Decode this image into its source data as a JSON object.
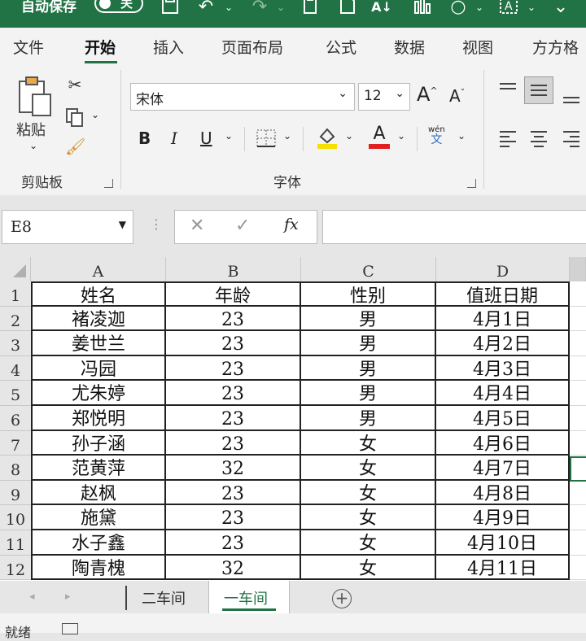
{
  "titlebar": {
    "autosave_label": "自动保存",
    "autosave_state": "关"
  },
  "ribbon_tabs": [
    "文件",
    "开始",
    "插入",
    "页面布局",
    "公式",
    "数据",
    "视图",
    "方方格"
  ],
  "active_tab": "开始",
  "clipboard": {
    "paste_label": "粘贴",
    "group_label": "剪贴板"
  },
  "font": {
    "font_name": "宋体",
    "font_size": "12",
    "group_label": "字体",
    "bold": "B",
    "italic": "I",
    "underline": "U",
    "grow": "A",
    "shrink": "A",
    "font_color": "A",
    "phonetic_top": "wén",
    "phonetic_bottom": "文"
  },
  "formula_bar": {
    "name_box": "E8",
    "fx": "fx",
    "formula": ""
  },
  "grid": {
    "columns": [
      "A",
      "B",
      "C",
      "D"
    ],
    "rows": [
      {
        "n": "1",
        "cells": [
          "姓名",
          "年龄",
          "性别",
          "值班日期"
        ]
      },
      {
        "n": "2",
        "cells": [
          "褚凌迦",
          "23",
          "男",
          "4月1日"
        ]
      },
      {
        "n": "3",
        "cells": [
          "姜世兰",
          "23",
          "男",
          "4月2日"
        ]
      },
      {
        "n": "4",
        "cells": [
          "冯园",
          "23",
          "男",
          "4月3日"
        ]
      },
      {
        "n": "5",
        "cells": [
          "尤朱婷",
          "23",
          "男",
          "4月4日"
        ]
      },
      {
        "n": "6",
        "cells": [
          "郑悦明",
          "23",
          "男",
          "4月5日"
        ]
      },
      {
        "n": "7",
        "cells": [
          "孙子涵",
          "23",
          "女",
          "4月6日"
        ]
      },
      {
        "n": "8",
        "cells": [
          "范黄萍",
          "32",
          "女",
          "4月7日"
        ]
      },
      {
        "n": "9",
        "cells": [
          "赵枫",
          "23",
          "女",
          "4月8日"
        ]
      },
      {
        "n": "10",
        "cells": [
          "施黛",
          "23",
          "女",
          "4月9日"
        ]
      },
      {
        "n": "11",
        "cells": [
          "水子鑫",
          "23",
          "女",
          "4月10日"
        ]
      },
      {
        "n": "12",
        "cells": [
          "陶青槐",
          "32",
          "女",
          "4月11日"
        ]
      }
    ],
    "selected_cell": "E8"
  },
  "sheets": {
    "tabs": [
      "二车间",
      "一车间"
    ],
    "active": "一车间",
    "add_label": "+"
  },
  "status": {
    "text": "就绪"
  },
  "colors": {
    "excel_green": "#217346",
    "font_color_bar": "#e02020",
    "highlight_bar": "#f5e000"
  }
}
